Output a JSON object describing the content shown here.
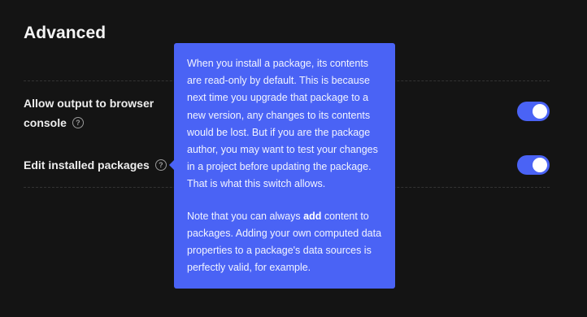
{
  "section": {
    "title": "Advanced"
  },
  "settings": [
    {
      "label_line1": "Allow output to browser",
      "label_line2": "console",
      "help_icon": "question-circle-icon",
      "enabled": true
    },
    {
      "label": "Edit installed packages",
      "help_icon": "question-circle-icon",
      "enabled": true
    }
  ],
  "tooltip": {
    "paragraph1": "When you install a package, its contents are read-only by default. This is because next time you upgrade that package to a new version, any changes to its contents would be lost. But if you are the package author, you may want to test your changes in a project before updating the package. That is what this switch allows.",
    "paragraph2_before": "Note that you can always ",
    "paragraph2_bold": "add",
    "paragraph2_after": " content to packages. Adding your own computed data properties to a package's data sources is perfectly valid, for example."
  },
  "colors": {
    "background": "#141414",
    "accent": "#4a63f5",
    "text": "#ededed",
    "muted_icon": "#9a9a9a"
  }
}
